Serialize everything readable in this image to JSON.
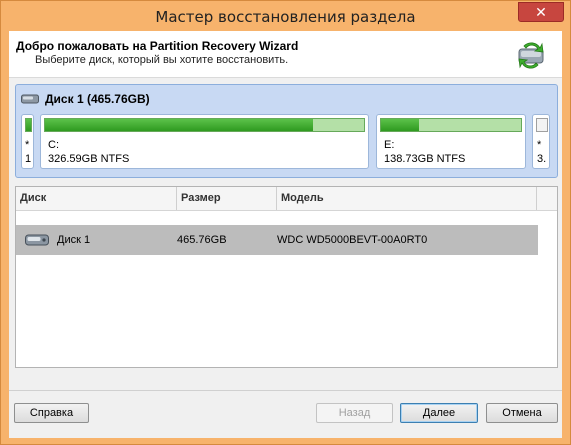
{
  "window": {
    "title": "Мастер восстановления раздела",
    "close_label": "✕"
  },
  "header": {
    "title": "Добро пожаловать на Partition Recovery Wizard",
    "subtitle": "Выберите диск, который вы хотите восстановить."
  },
  "disk_map": {
    "label": "Диск 1 (465.76GB)",
    "partitions": [
      {
        "name": "*",
        "info": "1",
        "used_pct": 100
      },
      {
        "name": "C:",
        "info": "326.59GB NTFS",
        "used_pct": 84
      },
      {
        "name": "E:",
        "info": "138.73GB NTFS",
        "used_pct": 27
      },
      {
        "name": "*",
        "info": "3.",
        "used_pct": 0
      }
    ]
  },
  "table": {
    "columns": [
      "Диск",
      "Размер",
      "Модель"
    ],
    "rows": [
      {
        "disk": "Диск 1",
        "size": "465.76GB",
        "model": "WDC WD5000BEVT-00A0RT0"
      }
    ]
  },
  "buttons": {
    "help": "Справка",
    "back": "Назад",
    "next": "Далее",
    "cancel": "Отмена"
  },
  "colors": {
    "titlebar": "#f7b36c",
    "close": "#c7463f",
    "panel": "#c8d9f3",
    "bar_fill": "#3aa82a"
  },
  "icons": [
    "hdd-icon",
    "wizard-icon",
    "close-icon"
  ]
}
